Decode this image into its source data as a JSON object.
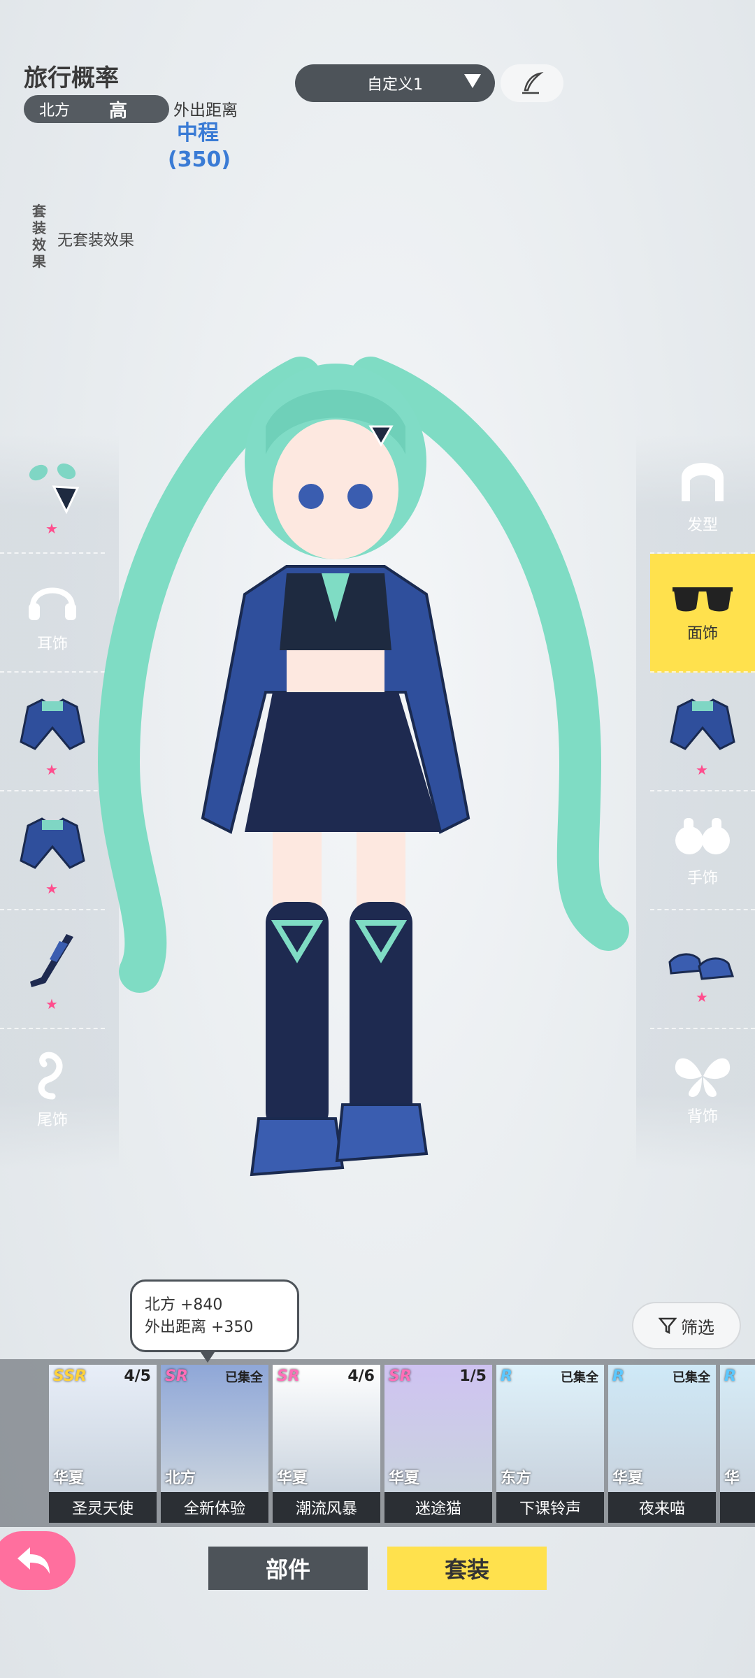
{
  "header": {
    "title": "旅行概率",
    "direction": "北方",
    "level": "高",
    "distance_label": "外出距离",
    "distance_value": "中程",
    "distance_number": "(350)",
    "set_effect_label": "套装效果",
    "set_effect_value": "无套装效果"
  },
  "preset": {
    "selected": "自定义1"
  },
  "left_slots": [
    {
      "label": "",
      "icon": "hair-clip-icon",
      "starred": true
    },
    {
      "label": "耳饰",
      "icon": "headphones-icon",
      "starred": false
    },
    {
      "label": "",
      "icon": "outfit-top-icon",
      "starred": true
    },
    {
      "label": "",
      "icon": "outfit-top-icon",
      "starred": true
    },
    {
      "label": "",
      "icon": "stockings-icon",
      "starred": true
    },
    {
      "label": "尾饰",
      "icon": "tail-icon",
      "starred": false
    }
  ],
  "right_slots": [
    {
      "label": "发型",
      "icon": "hairstyle-icon",
      "starred": false,
      "active": false
    },
    {
      "label": "面饰",
      "icon": "sunglasses-icon",
      "starred": false,
      "active": true
    },
    {
      "label": "",
      "icon": "outfit-top-icon",
      "starred": true,
      "active": false
    },
    {
      "label": "手饰",
      "icon": "gloves-icon",
      "starred": false,
      "active": false
    },
    {
      "label": "",
      "icon": "shoes-icon",
      "starred": true,
      "active": false
    },
    {
      "label": "背饰",
      "icon": "wings-icon",
      "starred": false,
      "active": false
    }
  ],
  "tooltip": {
    "line1": "北方 +840",
    "line2": "外出距离 +350"
  },
  "filter_label": "筛选",
  "cards": [
    {
      "rarity": "SSR",
      "count": "4/5",
      "region": "华夏",
      "name": "圣灵天使",
      "selected": false,
      "color": "#e8eef8"
    },
    {
      "rarity": "SR",
      "count": "已集全",
      "region": "北方",
      "name": "全新体验",
      "selected": true,
      "color": "#8fa7d8"
    },
    {
      "rarity": "SR",
      "count": "4/6",
      "region": "华夏",
      "name": "潮流风暴",
      "selected": false,
      "color": "#ffffff"
    },
    {
      "rarity": "SR",
      "count": "1/5",
      "region": "华夏",
      "name": "迷途猫",
      "selected": false,
      "color": "#cfc3f2"
    },
    {
      "rarity": "R",
      "count": "已集全",
      "region": "东方",
      "name": "下课铃声",
      "selected": false,
      "color": "#dff2fb"
    },
    {
      "rarity": "R",
      "count": "已集全",
      "region": "华夏",
      "name": "夜来喵",
      "selected": false,
      "color": "#cfe9f7"
    },
    {
      "rarity": "R",
      "count": "",
      "region": "华",
      "name": "",
      "selected": false,
      "color": "#d6ecf7"
    }
  ],
  "tabs": {
    "parts": "部件",
    "outfit": "套装"
  },
  "colors": {
    "accent_yellow": "#ffe14d",
    "dark_pill": "#4d5359",
    "distance_blue": "#3a7bd5",
    "back_pink": "#ff6f9e"
  }
}
